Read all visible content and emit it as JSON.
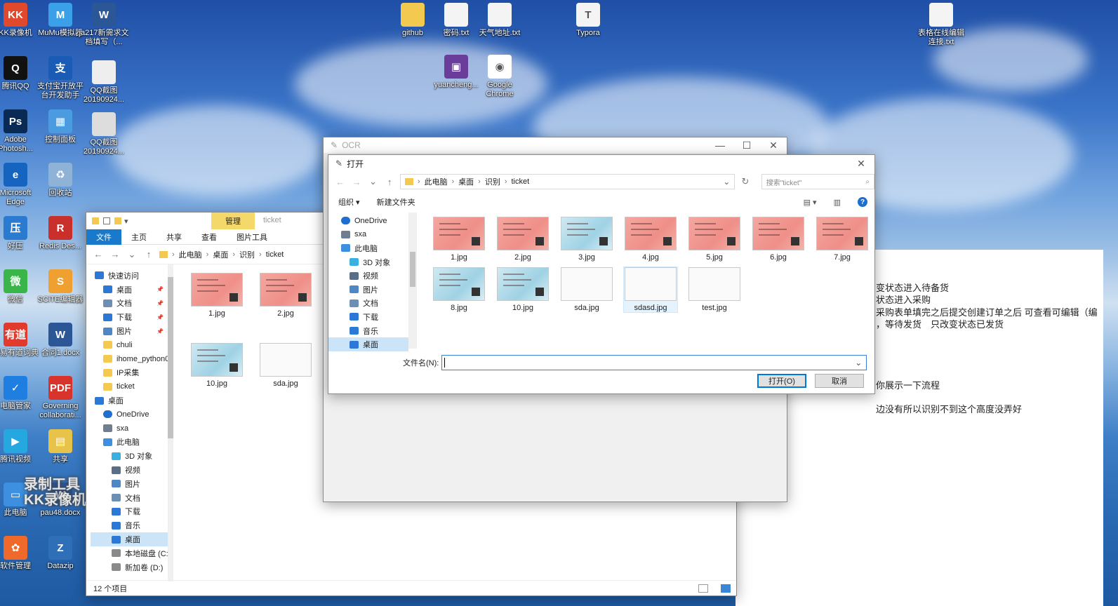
{
  "desktop_icons_col1": [
    {
      "label": "KK录像机",
      "icon": "camera-icon",
      "color": "#e0492b",
      "glyph": "KK"
    },
    {
      "label": "腾讯QQ",
      "icon": "qq-penguin-icon",
      "color": "#111111",
      "glyph": "Q"
    },
    {
      "label": "Adobe Photosh...",
      "icon": "photoshop-icon",
      "color": "#0a2a56",
      "glyph": "Ps"
    },
    {
      "label": "Microsoft Edge",
      "icon": "edge-icon",
      "color": "#1565c0",
      "glyph": "e"
    },
    {
      "label": "好压",
      "icon": "archive-icon",
      "color": "#2a7ad0",
      "glyph": "压"
    },
    {
      "label": "微信",
      "icon": "wechat-icon",
      "color": "#39b54a",
      "glyph": "微"
    },
    {
      "label": "网易有道词典",
      "icon": "youdao-icon",
      "color": "#e03b2c",
      "glyph": "有道"
    },
    {
      "label": "电脑管家",
      "icon": "pc-manager-icon",
      "color": "#1e7fe0",
      "glyph": "✓"
    },
    {
      "label": "腾讯视频",
      "icon": "tencent-video-icon",
      "color": "#25a8e0",
      "glyph": "▶"
    },
    {
      "label": "此电脑",
      "icon": "this-pc-icon",
      "color": "#3d8fe0",
      "glyph": "▭"
    },
    {
      "label": "软件管理",
      "icon": "software-manager-icon",
      "color": "#ef6a2a",
      "glyph": "✿"
    }
  ],
  "desktop_icons_col2": [
    {
      "label": "MuMu模拟器",
      "icon": "mumu-icon",
      "color": "#3aa0e8",
      "glyph": "M"
    },
    {
      "label": "支付宝开放平台开发助手",
      "icon": "alipay-dev-icon",
      "color": "#1a5bb5",
      "glyph": "支"
    },
    {
      "label": "控制面板",
      "icon": "control-panel-icon",
      "color": "#4b9be0",
      "glyph": "▦"
    },
    {
      "label": "回收站",
      "icon": "recycle-bin-icon",
      "color": "#8fb3d6",
      "glyph": "♻"
    },
    {
      "label": "Redis Des...",
      "icon": "redis-icon",
      "color": "#c9302c",
      "glyph": "R"
    },
    {
      "label": "SCiTE编辑器",
      "icon": "scite-icon",
      "color": "#f0a030",
      "glyph": "S"
    },
    {
      "label": "合同1.docx",
      "icon": "word-doc-icon",
      "color": "#2b5797",
      "glyph": "W"
    },
    {
      "label": "Governing collaborati...",
      "icon": "pdf-icon",
      "color": "#d9342b",
      "glyph": "PDF"
    },
    {
      "label": "共享",
      "icon": "share-folder-icon",
      "color": "#e8c34a",
      "glyph": "▤"
    },
    {
      "label": "pau48.docx",
      "icon": "word-doc-icon",
      "color": "#2b5797",
      "glyph": "W"
    },
    {
      "label": "Datazip",
      "icon": "datazip-icon",
      "color": "#2f6fb8",
      "glyph": "Z"
    }
  ],
  "desktop_icons_misc": [
    {
      "label": "ja217新需求文档填写（...",
      "icon": "word-doc-icon",
      "color": "#2b5797",
      "glyph": "W"
    },
    {
      "label": "QQ截图20190924...",
      "icon": "screenshot-icon",
      "color": "#eeeeee",
      "glyph": ""
    },
    {
      "label": "QQ截图20190924...",
      "icon": "screenshot-icon",
      "color": "#dddddd",
      "glyph": ""
    },
    {
      "label": "github",
      "icon": "folder-icon",
      "color": "#f3c94f",
      "glyph": ""
    },
    {
      "label": "密码.txt",
      "icon": "text-file-icon",
      "color": "#f4f4f4",
      "glyph": ""
    },
    {
      "label": "天气地址.txt",
      "icon": "text-file-icon",
      "color": "#f4f4f4",
      "glyph": ""
    },
    {
      "label": "Typora",
      "icon": "typora-icon",
      "color": "#f4f4f4",
      "glyph": "T"
    },
    {
      "label": "表格在线编辑连接.txt",
      "icon": "text-file-icon",
      "color": "#f4f4f4",
      "glyph": ""
    },
    {
      "label": "yuancheng...",
      "icon": "winrar-icon",
      "color": "#6a3d9a",
      "glyph": "▣"
    },
    {
      "label": "Google Chrome",
      "icon": "chrome-icon",
      "color": "#ffffff",
      "glyph": "◉"
    }
  ],
  "watermark": {
    "line1": "录制工具",
    "line2": "KK录像机"
  },
  "explorer": {
    "quick_tab": "管理",
    "title": "ticket",
    "ribbon_tabs": [
      "文件",
      "主页",
      "共享",
      "查看",
      "图片工具"
    ],
    "address": [
      "此电脑",
      "桌面",
      "识别",
      "ticket"
    ],
    "tree": [
      {
        "label": "快速访问",
        "icon": "star-icon",
        "indent": 0
      },
      {
        "label": "桌面",
        "icon": "desktop-folder-icon",
        "indent": 1,
        "pin": true
      },
      {
        "label": "文档",
        "icon": "documents-icon",
        "indent": 1,
        "pin": true
      },
      {
        "label": "下载",
        "icon": "download-icon",
        "indent": 1,
        "pin": true
      },
      {
        "label": "图片",
        "icon": "pictures-icon",
        "indent": 1,
        "pin": true
      },
      {
        "label": "chuli",
        "icon": "folder-icon",
        "indent": 1
      },
      {
        "label": "ihome_python0",
        "icon": "folder-icon",
        "indent": 1
      },
      {
        "label": "IP采集",
        "icon": "folder-icon",
        "indent": 1
      },
      {
        "label": "ticket",
        "icon": "folder-icon",
        "indent": 1
      },
      {
        "label": "桌面",
        "icon": "desktop-folder-icon",
        "indent": 0
      },
      {
        "label": "OneDrive",
        "icon": "onedrive-icon",
        "indent": 1
      },
      {
        "label": "sxa",
        "icon": "user-icon",
        "indent": 1
      },
      {
        "label": "此电脑",
        "icon": "this-pc-icon",
        "indent": 1
      },
      {
        "label": "3D 对象",
        "icon": "3d-objects-icon",
        "indent": 2
      },
      {
        "label": "视频",
        "icon": "videos-icon",
        "indent": 2
      },
      {
        "label": "图片",
        "icon": "pictures-icon",
        "indent": 2
      },
      {
        "label": "文档",
        "icon": "documents-icon",
        "indent": 2
      },
      {
        "label": "下载",
        "icon": "download-icon",
        "indent": 2
      },
      {
        "label": "音乐",
        "icon": "music-icon",
        "indent": 2
      },
      {
        "label": "桌面",
        "icon": "desktop-folder-icon",
        "indent": 2,
        "selected": true
      },
      {
        "label": "本地磁盘 (C:)",
        "icon": "drive-icon",
        "indent": 2
      },
      {
        "label": "新加卷 (D:)",
        "icon": "drive-icon",
        "indent": 2
      }
    ],
    "files": [
      {
        "name": "1.jpg",
        "style": "pink"
      },
      {
        "name": "2.jpg",
        "style": "pink"
      },
      {
        "name": "10.jpg",
        "style": "teal"
      },
      {
        "name": "sda.jpg",
        "style": "white"
      }
    ],
    "status": "12 个项目"
  },
  "ocr_window": {
    "title": "OCR"
  },
  "open_dialog": {
    "title": "打开",
    "address": [
      "此电脑",
      "桌面",
      "识别",
      "ticket"
    ],
    "search_placeholder": "搜索\"ticket\"",
    "organize": "组织 ▾",
    "new_folder": "新建文件夹",
    "tree": [
      {
        "label": "OneDrive",
        "icon": "onedrive-icon",
        "indent": 1
      },
      {
        "label": "sxa",
        "icon": "user-icon",
        "indent": 1
      },
      {
        "label": "此电脑",
        "icon": "this-pc-icon",
        "indent": 1
      },
      {
        "label": "3D 对象",
        "icon": "3d-objects-icon",
        "indent": 2
      },
      {
        "label": "视频",
        "icon": "videos-icon",
        "indent": 2
      },
      {
        "label": "图片",
        "icon": "pictures-icon",
        "indent": 2
      },
      {
        "label": "文档",
        "icon": "documents-icon",
        "indent": 2
      },
      {
        "label": "下载",
        "icon": "download-icon",
        "indent": 2
      },
      {
        "label": "音乐",
        "icon": "music-icon",
        "indent": 2
      },
      {
        "label": "桌面",
        "icon": "desktop-folder-icon",
        "indent": 2,
        "selected": true
      }
    ],
    "files": [
      {
        "name": "1.jpg",
        "style": "pink"
      },
      {
        "name": "2.jpg",
        "style": "pink"
      },
      {
        "name": "3.jpg",
        "style": "teal"
      },
      {
        "name": "4.jpg",
        "style": "pink"
      },
      {
        "name": "5.jpg",
        "style": "pink"
      },
      {
        "name": "6.jpg",
        "style": "pink"
      },
      {
        "name": "7.jpg",
        "style": "pink"
      },
      {
        "name": "8.jpg",
        "style": "teal"
      },
      {
        "name": "10.jpg",
        "style": "teal"
      },
      {
        "name": "sda.jpg",
        "style": "white"
      },
      {
        "name": "sdasd.jpg",
        "style": "white",
        "hover": true
      },
      {
        "name": "test.jpg",
        "style": "white"
      }
    ],
    "filename_label": "文件名(N):",
    "filename_value": "",
    "open_button": "打开(O)",
    "cancel_button": "取消"
  },
  "doc_notes": [
    "变状态进入待备货",
    "状态进入采购",
    "采购表单填完之后提交创建订单之后 可查看可编辑（编",
    "，等待发货　只改变状态已发货",
    "你展示一下流程",
    "边没有所以识别不到这个高度没弄好"
  ]
}
